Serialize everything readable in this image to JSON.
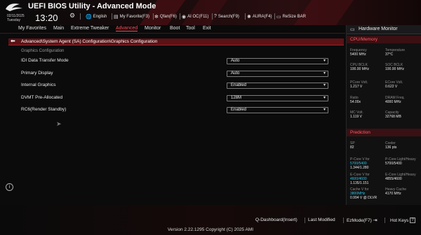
{
  "header": {
    "title": "UEFI BIOS Utility - Advanced Mode",
    "date": "02/11/2025",
    "day": "Tuesday",
    "time": "13:20",
    "buttons": [
      {
        "icon": "globe-icon",
        "label": "English"
      },
      {
        "icon": "star-icon",
        "label": "My Favorite(F3)"
      },
      {
        "icon": "fan-icon",
        "label": "Qfan(F6)"
      },
      {
        "icon": "ai-icon",
        "label": "AI OC(F11)"
      },
      {
        "icon": "help-icon",
        "label": "Search(F9)"
      },
      {
        "icon": "aura-icon",
        "label": "AURA(F4)"
      },
      {
        "icon": "resize-icon",
        "label": "ReSize BAR"
      }
    ]
  },
  "menu": {
    "items": [
      "My Favorites",
      "Main",
      "Extreme Tweaker",
      "Advanced",
      "Monitor",
      "Boot",
      "Tool",
      "Exit"
    ],
    "active": "Advanced"
  },
  "breadcrumb": "Advanced\\System Agent (SA) Configuration\\Graphics Configuration",
  "section_title": "Graphics Configuration",
  "settings": [
    {
      "label": "IDI Data Transfer Mode",
      "value": "Auto"
    },
    {
      "label": "Primary Display",
      "value": "Auto"
    },
    {
      "label": "Internal Graphics",
      "value": "Enabled"
    },
    {
      "label": "DVMT Pre-Allocated",
      "value": "128M"
    },
    {
      "label": "RC6(Render Standby)",
      "value": "Enabled"
    }
  ],
  "hw_monitor": {
    "title": "Hardware Monitor",
    "cpu_section": "CPU/Memory",
    "cpu": [
      {
        "k": "Frequency",
        "v": "5400 MHz"
      },
      {
        "k": "Temperature",
        "v": "37°C"
      },
      {
        "k": "CPU BCLK",
        "v": "100.00 MHz"
      },
      {
        "k": "SOC BCLK",
        "v": "100.00 MHz"
      },
      {
        "k": "PCore Volt.",
        "v": "1.217 V"
      },
      {
        "k": "ECore Volt.",
        "v": "0.622 V"
      },
      {
        "k": "Ratio",
        "v": "54.00x"
      },
      {
        "k": "DRAM Freq.",
        "v": "4000 MHz"
      },
      {
        "k": "MC Volt.",
        "v": "1.119 V"
      },
      {
        "k": "Capacity",
        "v": "32768 MB"
      }
    ],
    "pred_section": "Prediction",
    "pred": {
      "sp_k": "SP",
      "sp_v": "82",
      "cooler_k": "Cooler",
      "cooler_v": "136 pts",
      "pcore_k": "P-Core V for",
      "pcore_a": "5700/5400",
      "pcore_v": "1.344/1.280",
      "pcore_lh_k": "P-Core Light/Heavy",
      "pcore_lh_v": "5700/5400",
      "ecore_k": "E-Core V for",
      "ecore_a": "4600/4600",
      "ecore_v": "1.135/1.151",
      "ecore_lh_k": "E-Core Light/Heavy",
      "ecore_lh_v": "4855/4600",
      "cache_k": "Cache V for",
      "cache_a": "3800MHz",
      "cache_v": "0.994 V @ DLVR",
      "hcache_k": "Heavy Cache",
      "hcache_v": "4170 MHz"
    }
  },
  "footer": {
    "buttons": [
      {
        "label": "Q-Dashboard(Insert)",
        "icon": ""
      },
      {
        "label": "Last Modified",
        "icon": ""
      },
      {
        "label": "EzMode(F7)",
        "icon": "ezmode-icon"
      },
      {
        "label": "Hot Keys",
        "icon": "hotkeys-icon"
      }
    ],
    "version": "Version 2.22.1295 Copyright (C) 2025 AMI"
  }
}
